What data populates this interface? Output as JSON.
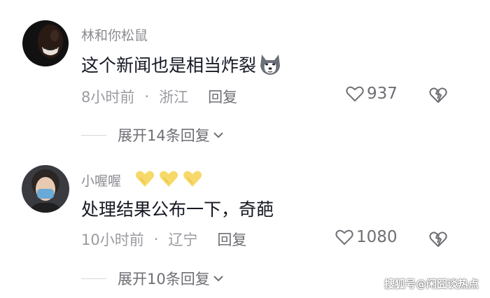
{
  "comments": [
    {
      "username": "林和你松鼠",
      "text": "这个新闻也是相当炸裂",
      "emoji_icon": "husky-dog-emoji-icon",
      "time": "8小时前",
      "separator": "·",
      "location": "浙江",
      "reply_label": "回复",
      "likes": "937",
      "expand_label": "展开14条回复"
    },
    {
      "username": "小喔喔",
      "badges": [
        "heart-hands-icon",
        "heart-hands-icon",
        "heart-hands-icon"
      ],
      "text": "处理结果公布一下，奇葩",
      "time": "10小时前",
      "separator": "·",
      "location": "辽宁",
      "reply_label": "回复",
      "likes": "1080",
      "expand_label": "展开10条回复"
    }
  ],
  "watermark": "搜狐号@闲囧谈热点",
  "colors": {
    "text": "#161823",
    "meta": "#9a9ba0",
    "badge": "#f7d96a"
  }
}
